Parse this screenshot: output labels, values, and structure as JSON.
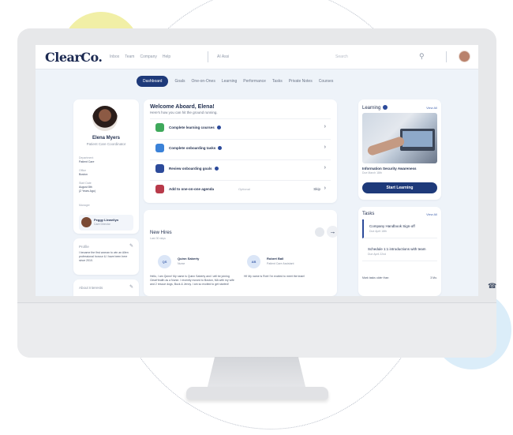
{
  "brand": {
    "logo_main": "Clear",
    "logo_suffix": "Co."
  },
  "topbar": {
    "links": [
      "Inbox",
      "Team",
      "Company",
      "Help"
    ],
    "search_text": "AI Assi",
    "search_placeholder": "Search"
  },
  "nav": {
    "tabs": [
      {
        "label": "Dashboard",
        "active": true
      },
      {
        "label": "Goals"
      },
      {
        "label": "One-on-Ones"
      },
      {
        "label": "Learning"
      },
      {
        "label": "Performance"
      },
      {
        "label": "Tasks"
      },
      {
        "label": "Private Notes"
      },
      {
        "label": "Courses"
      }
    ]
  },
  "profile": {
    "name": "Elena Myers",
    "role": "Patient Care Coordinator",
    "fields": [
      {
        "label": "Department",
        "value": "Patient Care"
      },
      {
        "label": "Office",
        "value": "Boston"
      },
      {
        "label": "Start Date",
        "value": "August 8th"
      },
      {
        "label": "",
        "value": "(2 Years Ago)"
      }
    ],
    "manager_label": "Manager",
    "manager": {
      "name": "Peggy Llewellyn",
      "role": "Care Director"
    }
  },
  "about": {
    "title": "Profile",
    "text": "I became the first woman to win an Allen professional honour & I have been here since 2010."
  },
  "about2": {
    "title": "About Interests"
  },
  "welcome": {
    "title": "Welcome Aboard, Elena!",
    "subtitle": "Here's how you can hit the ground running.",
    "tasks": [
      {
        "label": "Complete learning courses",
        "color": "#3fa95b",
        "extra": ""
      },
      {
        "label": "Complete onboarding tasks",
        "color": "#3b82d8",
        "extra": ""
      },
      {
        "label": "Review onboarding goals",
        "color": "#2c4a9a",
        "extra": ""
      },
      {
        "label": "Add to one-on-one agenda",
        "color": "#b83a4a",
        "extra": "Optional",
        "skip": "Skip"
      }
    ]
  },
  "new_hires": {
    "title": "New Hires",
    "subtitle": "Last 30 days",
    "hires": [
      {
        "initials": "QS",
        "name": "Quinn Saberty",
        "role": "Nurse",
        "text": "Hello, I am Quinn! My name is Quinn Saberty and I will be joining ClearHealth as a Nurse. I recently moved to Boston, MA with my wife and 2 rescue dogs, Buck & Jenny. I am so excited to get started!"
      },
      {
        "initials": "AB",
        "name": "Robert Ball",
        "role": "Patient Care Assistant",
        "text": "Hi! My name is Rob! I'm excited to meet the team!"
      }
    ]
  },
  "learning": {
    "title": "Learning",
    "view_all": "View All",
    "course": "Information Security Awareness",
    "course_sub": "Due March 18th",
    "button": "Start Learning"
  },
  "tasks": {
    "title": "Tasks",
    "view_all": "View All",
    "items": [
      {
        "title": "Company Handbook Sign-off",
        "sub": "Due April 18th"
      },
      {
        "title": "Schedule 1:1 introductions with team",
        "sub": "Due April 22nd"
      }
    ],
    "footer_left": "Mark tasks older than",
    "footer_right": "3 Mo."
  }
}
